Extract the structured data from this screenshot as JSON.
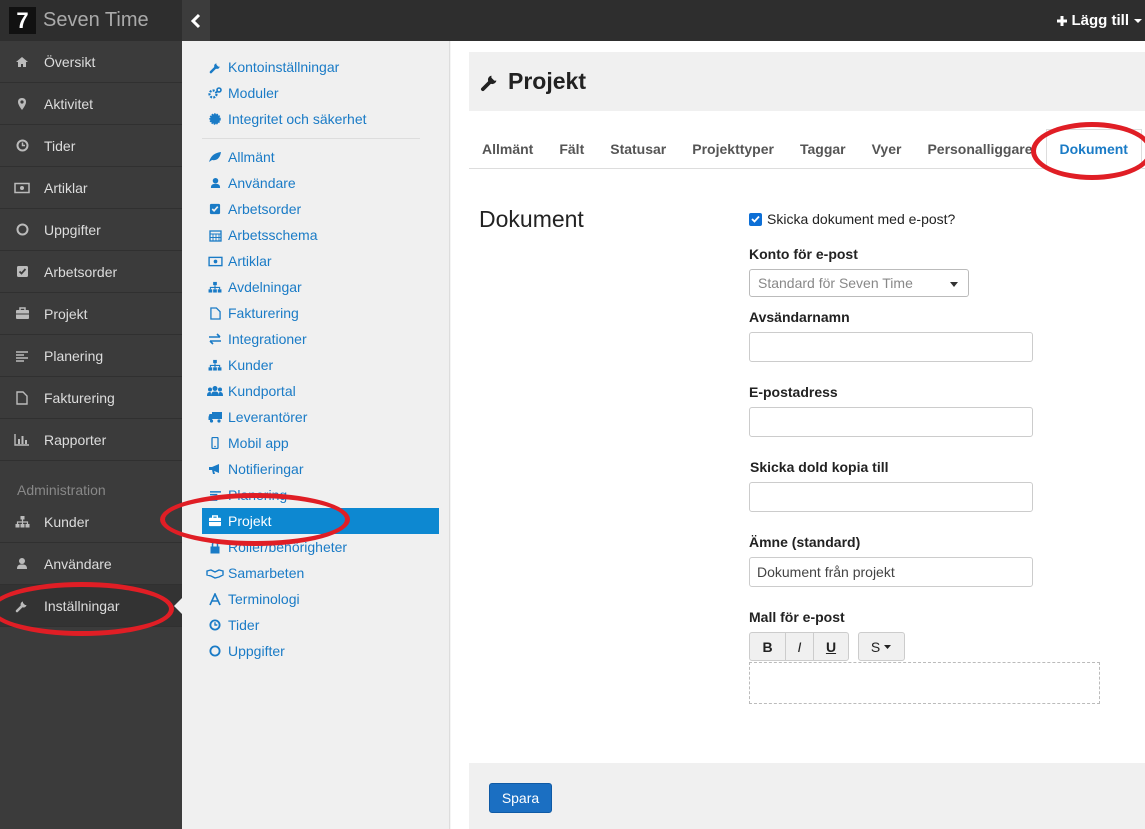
{
  "app": {
    "logo_glyph": "7",
    "name": "Seven Time",
    "add_label": "Lägg till"
  },
  "sidebar": {
    "items": [
      {
        "label": "Översikt",
        "icon": "home-icon"
      },
      {
        "label": "Aktivitet",
        "icon": "map-marker-icon"
      },
      {
        "label": "Tider",
        "icon": "clock-icon"
      },
      {
        "label": "Artiklar",
        "icon": "money-icon"
      },
      {
        "label": "Uppgifter",
        "icon": "circle-icon"
      },
      {
        "label": "Arbetsorder",
        "icon": "check-square-icon"
      },
      {
        "label": "Projekt",
        "icon": "briefcase-icon"
      },
      {
        "label": "Planering",
        "icon": "align-left-icon"
      },
      {
        "label": "Fakturering",
        "icon": "file-icon"
      },
      {
        "label": "Rapporter",
        "icon": "bar-chart-icon"
      }
    ],
    "section_label": "Administration",
    "admin_items": [
      {
        "label": "Kunder",
        "icon": "sitemap-icon"
      },
      {
        "label": "Användare",
        "icon": "user-icon"
      },
      {
        "label": "Inställningar",
        "icon": "wrench-icon"
      }
    ]
  },
  "submenu": {
    "top_items": [
      {
        "label": "Kontoinställningar",
        "icon": "wrench-icon"
      },
      {
        "label": "Moduler",
        "icon": "cogs-icon"
      },
      {
        "label": "Integritet och säkerhet",
        "icon": "certificate-icon"
      }
    ],
    "items": [
      {
        "label": "Allmänt",
        "icon": "leaf-icon"
      },
      {
        "label": "Användare",
        "icon": "user-icon"
      },
      {
        "label": "Arbetsorder",
        "icon": "check-square-icon"
      },
      {
        "label": "Arbetsschema",
        "icon": "calendar-icon"
      },
      {
        "label": "Artiklar",
        "icon": "money-icon"
      },
      {
        "label": "Avdelningar",
        "icon": "sitemap-icon"
      },
      {
        "label": "Fakturering",
        "icon": "file-icon"
      },
      {
        "label": "Integrationer",
        "icon": "exchange-icon"
      },
      {
        "label": "Kunder",
        "icon": "sitemap-icon"
      },
      {
        "label": "Kundportal",
        "icon": "users-icon"
      },
      {
        "label": "Leverantörer",
        "icon": "truck-icon"
      },
      {
        "label": "Mobil app",
        "icon": "mobile-icon"
      },
      {
        "label": "Notifieringar",
        "icon": "bullhorn-icon"
      },
      {
        "label": "Planering",
        "icon": "align-left-icon"
      },
      {
        "label": "Projekt",
        "icon": "briefcase-icon"
      },
      {
        "label": "Roller/behörigheter",
        "icon": "lock-icon"
      },
      {
        "label": "Samarbeten",
        "icon": "handshake-icon"
      },
      {
        "label": "Terminologi",
        "icon": "font-icon"
      },
      {
        "label": "Tider",
        "icon": "clock-icon"
      },
      {
        "label": "Uppgifter",
        "icon": "circle-icon"
      }
    ],
    "selected": "Projekt"
  },
  "page": {
    "title": "Projekt",
    "tabs": [
      "Allmänt",
      "Fält",
      "Statusar",
      "Projekttyper",
      "Taggar",
      "Vyer",
      "Personalliggare",
      "Dokument"
    ],
    "active_tab": "Dokument",
    "section_title": "Dokument"
  },
  "form": {
    "send_docs_label": "Skicka dokument med e-post?",
    "send_docs_checked": true,
    "account_label": "Konto för e-post",
    "account_value": "Standard för Seven Time",
    "sender_name_label": "Avsändarnamn",
    "sender_name_value": "",
    "email_label": "E-postadress",
    "email_value": "",
    "bcc_label": "Skicka dold kopia till",
    "bcc_value": "",
    "subject_label": "Ämne (standard)",
    "subject_value": "Dokument från projekt",
    "template_label": "Mall för e-post",
    "toolbar": {
      "bold": "B",
      "italic": "I",
      "underline": "U",
      "style": "S"
    },
    "save_label": "Spara"
  },
  "colors": {
    "accent": "#1a7bc6",
    "selected": "#0d88d1",
    "annotation": "#e01e25"
  }
}
